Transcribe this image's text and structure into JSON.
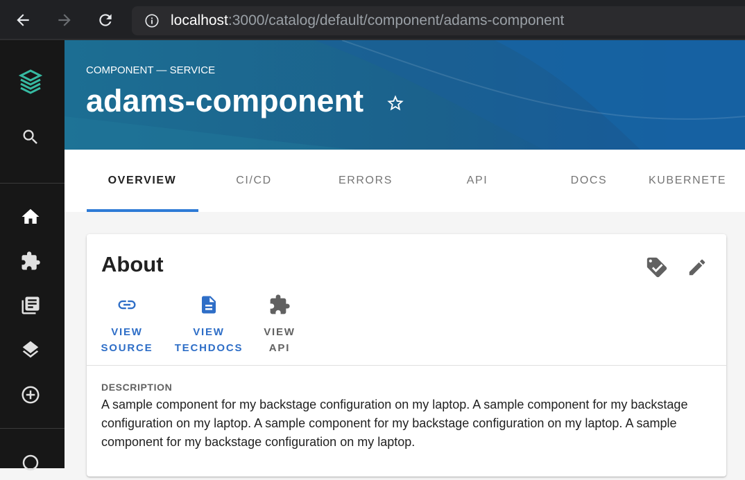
{
  "browser": {
    "url_host": "localhost",
    "url_path": ":3000/catalog/default/component/adams-component"
  },
  "sidebar": {
    "items": [
      {
        "icon": "backstage-logo-icon"
      },
      {
        "icon": "search-icon"
      },
      {
        "icon": "home-icon"
      },
      {
        "icon": "puzzle-icon"
      },
      {
        "icon": "library-books-icon"
      },
      {
        "icon": "layers-icon"
      },
      {
        "icon": "add-circle-icon"
      }
    ]
  },
  "header": {
    "type_label": "COMPONENT — SERVICE",
    "title": "adams-component"
  },
  "tabs": [
    {
      "label": "OVERVIEW",
      "active": true
    },
    {
      "label": "CI/CD"
    },
    {
      "label": "ERRORS"
    },
    {
      "label": "API"
    },
    {
      "label": "DOCS"
    },
    {
      "label": "KUBERNETE"
    }
  ],
  "about": {
    "title": "About",
    "links": [
      {
        "line1": "VIEW",
        "line2": "SOURCE",
        "icon": "link-icon"
      },
      {
        "line1": "VIEW",
        "line2": "TECHDOCS",
        "icon": "document-icon"
      },
      {
        "line1": "VIEW",
        "line2": "API",
        "icon": "puzzle-icon"
      }
    ],
    "description_label": "DESCRIPTION",
    "description": "A sample component for my backstage configuration on my laptop. A sample component for my backstage configuration on my laptop. A sample component for my backstage configuration on my laptop. A sample component for my backstage configuration on my laptop."
  },
  "colors": {
    "header_start": "#1c6e93",
    "header_end": "#15549a",
    "tab_indicator": "#2e7bd6",
    "link": "#2e6ec7",
    "logo": "#36baa2"
  }
}
